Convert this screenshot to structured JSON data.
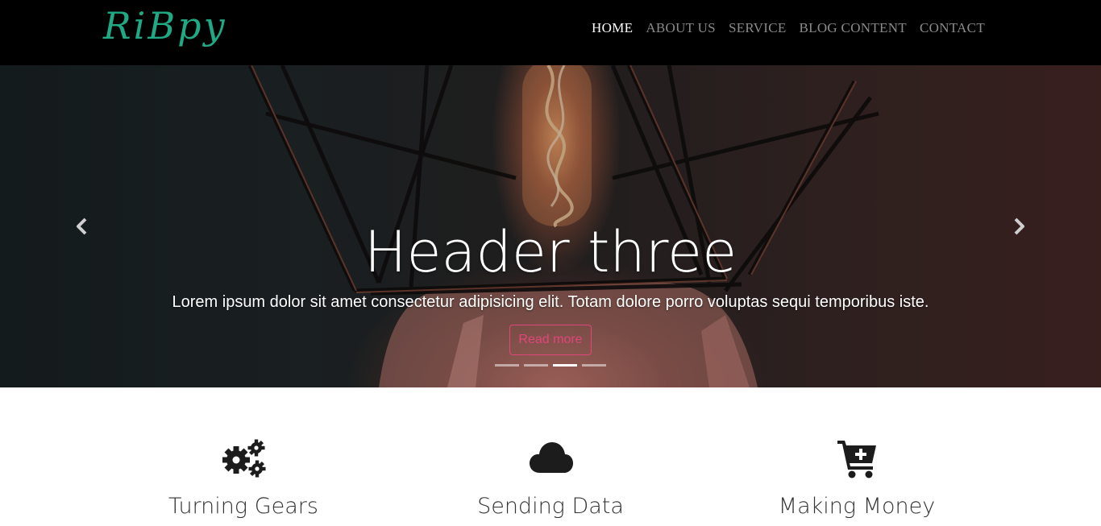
{
  "brand": {
    "logo_text": "RiBpy"
  },
  "nav": {
    "items": [
      {
        "label": "HOME",
        "active": true
      },
      {
        "label": "ABOUT US",
        "active": false
      },
      {
        "label": "SERVICE",
        "active": false
      },
      {
        "label": "BLOG CONTENT",
        "active": false
      },
      {
        "label": "CONTACT",
        "active": false
      }
    ]
  },
  "carousel": {
    "title": "Header three",
    "text": "Lorem ipsum dolor sit amet consectetur adipisicing elit. Totam dolore porro voluptas sequi temporibus iste.",
    "button_label": "Read more",
    "slide_count": 4,
    "active_slide": 3,
    "prev_icon": "chevron-left-icon",
    "next_icon": "chevron-right-icon"
  },
  "features": [
    {
      "title": "Turning Gears",
      "icon": "gears-icon"
    },
    {
      "title": "Sending Data",
      "icon": "cloud-icon"
    },
    {
      "title": "Making Money",
      "icon": "cart-plus-icon"
    }
  ],
  "colors": {
    "nav_bg": "#000000",
    "logo": "#1fa985",
    "nav_active": "#ffffff",
    "nav_inactive": "#8a8a8a",
    "button_accent": "#e0457b",
    "icon_dark": "#1c1c1c",
    "text_dark": "#333333"
  }
}
